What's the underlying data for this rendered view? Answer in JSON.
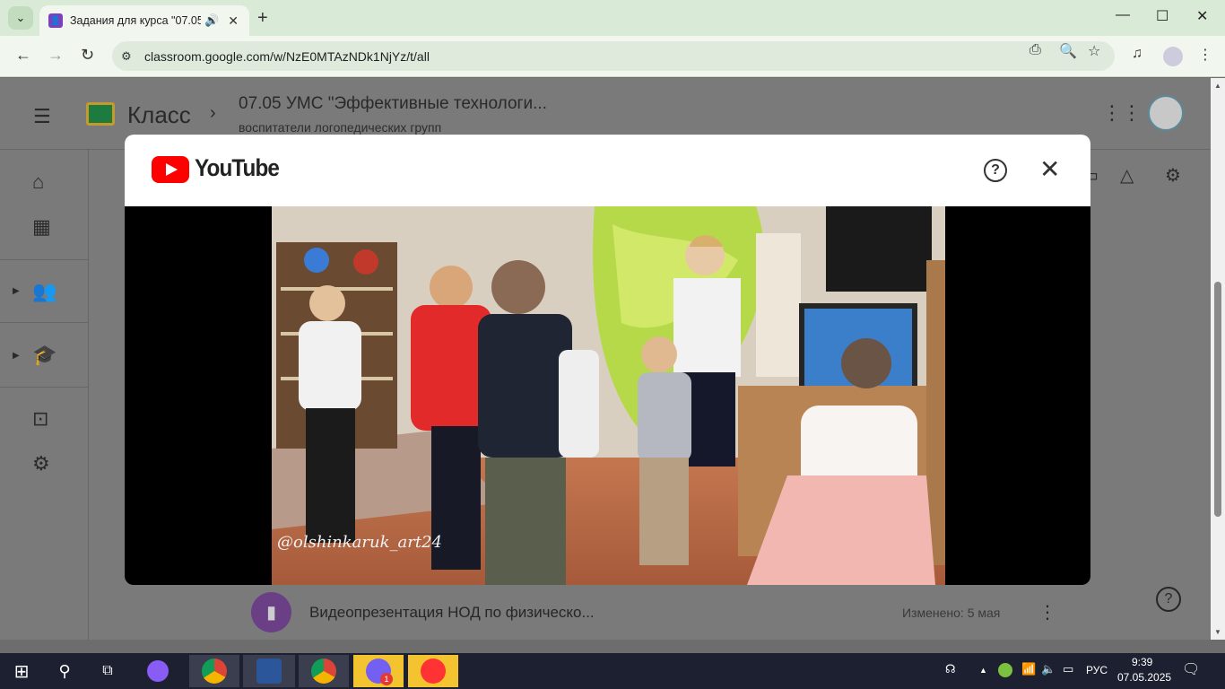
{
  "browser": {
    "tab_title": "Задания для курса \"07.05 У",
    "tab_audio_icon": "speaker-icon",
    "new_tab": "+",
    "url": "classroom.google.com/w/NzE0MTAzNDk1NjYz/t/all"
  },
  "classroom": {
    "brand": "Класс",
    "course_title": "07.05 УМС \"Эффективные технологи...",
    "course_subtitle": "воспитатели логопедических групп",
    "item": {
      "title": "Видеопрезентация НОД по физическо...",
      "modified": "Изменено: 5 мая"
    }
  },
  "modal": {
    "brand": "YouTube",
    "video_watermark": "@olshinkaruk_art24"
  },
  "taskbar": {
    "language": "РУС",
    "time": "9:39",
    "date": "07.05.2025",
    "viber_badge": "1"
  },
  "colors": {
    "tabbar_bg": "#d9ead7",
    "youtube_red": "#ff0000",
    "overlay": "#7a7a7a",
    "taskbar": "#1d2030"
  }
}
